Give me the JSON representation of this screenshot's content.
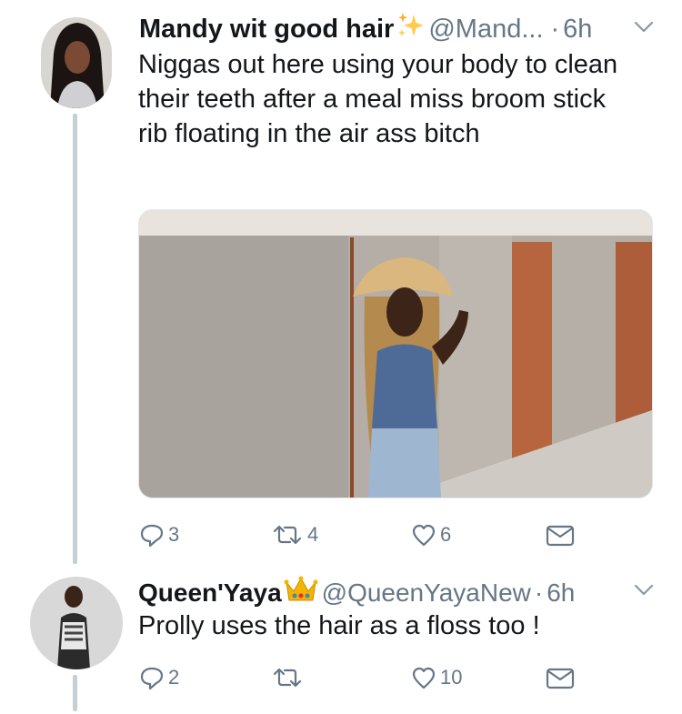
{
  "tweets": [
    {
      "name": "Mandy wit good hair",
      "name_emoji": "sparkles",
      "handle": "@Mand...",
      "separator": "·",
      "time": "6h",
      "text": "Niggas out here using your body to clean their teeth after a meal miss broom stick rib floating in the air ass bitch",
      "media": "photo of a person in a straw hat with long braids next to a brick and concrete wall",
      "replies": "3",
      "retweets": "4",
      "likes": "6"
    },
    {
      "name": "Queen'Yaya",
      "name_emoji": "crown",
      "handle": "@QueenYayaNew",
      "separator": "·",
      "time": "6h",
      "text": "Prolly uses the hair as a floss too !",
      "replies": "2",
      "retweets": "",
      "likes": "10"
    }
  ],
  "colors": {
    "text": "#14171a",
    "secondary": "#657786",
    "thread_line": "#c4cfd6"
  }
}
